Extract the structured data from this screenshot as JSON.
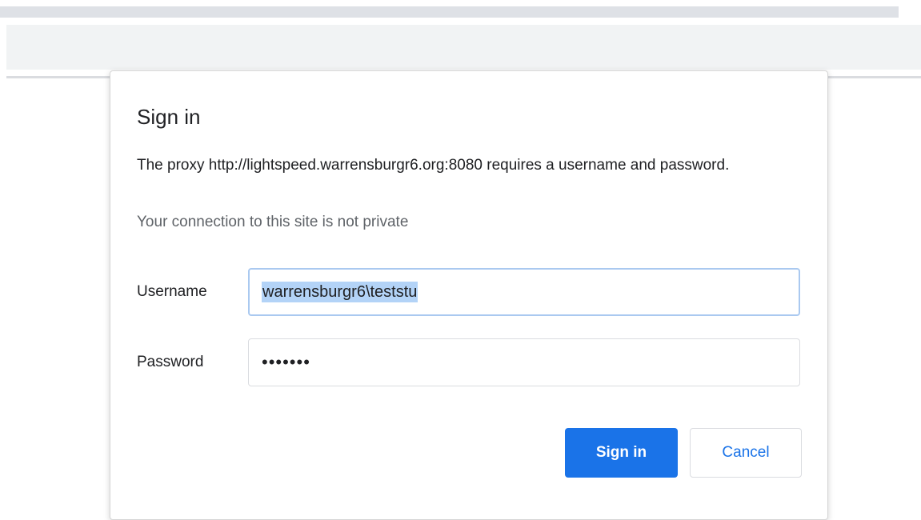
{
  "dialog": {
    "title": "Sign in",
    "message": "The proxy http://lightspeed.warrensburgr6.org:8080 requires a username and password.",
    "warning": "Your connection to this site is not private",
    "username_label": "Username",
    "username_value": "warrensburgr6\\teststu",
    "password_label": "Password",
    "password_value": "•••••••",
    "sign_in_button": "Sign in",
    "cancel_button": "Cancel"
  },
  "colors": {
    "accent": "#1a73e8",
    "selection": "#b3d3f7",
    "focus_border": "#aac9f0",
    "toolbar": "#f1f3f4"
  }
}
